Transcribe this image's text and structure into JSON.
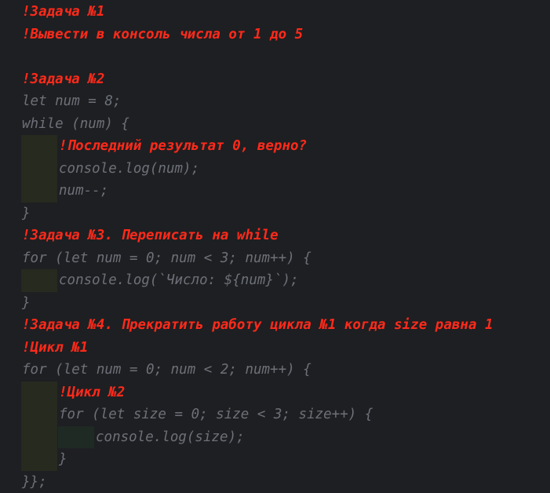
{
  "colors": {
    "background": "#1e1f22",
    "code_text": "#6d7078",
    "comment_text": "#ff2a1a",
    "indent_guide_level1": "#272a1f",
    "indent_guide_level2": "#1f2a25"
  },
  "code_lines": [
    {
      "type": "comment",
      "indent": 0,
      "text": "!Задача №1"
    },
    {
      "type": "comment",
      "indent": 0,
      "text": "!Вывести в консоль числа от 1 до 5"
    },
    {
      "type": "blank",
      "indent": 0,
      "text": ""
    },
    {
      "type": "comment",
      "indent": 0,
      "text": "!Задача №2"
    },
    {
      "type": "code",
      "indent": 0,
      "text": "let num = 8;"
    },
    {
      "type": "code",
      "indent": 0,
      "text": "while (num) {"
    },
    {
      "type": "comment",
      "indent": 1,
      "text": "!Последний результат 0, верно?"
    },
    {
      "type": "code",
      "indent": 1,
      "text": "console.log(num);"
    },
    {
      "type": "code",
      "indent": 1,
      "text": "num--;"
    },
    {
      "type": "code",
      "indent": 0,
      "text": "}"
    },
    {
      "type": "comment",
      "indent": 0,
      "text": "!Задача №3. Переписать на while"
    },
    {
      "type": "code",
      "indent": 0,
      "text": "for (let num = 0; num < 3; num++) {"
    },
    {
      "type": "code",
      "indent": 1,
      "text": "console.log(`Число: ${num}`);"
    },
    {
      "type": "code",
      "indent": 0,
      "text": "}"
    },
    {
      "type": "comment",
      "indent": 0,
      "text": "!Задача №4. Прекратить работу цикла №1 когда size равна 1"
    },
    {
      "type": "comment",
      "indent": 0,
      "text": "!Цикл №1"
    },
    {
      "type": "code",
      "indent": 0,
      "text": "for (let num = 0; num < 2; num++) {"
    },
    {
      "type": "comment",
      "indent": 1,
      "text": "!Цикл №2"
    },
    {
      "type": "code",
      "indent": 1,
      "text": "for (let size = 0; size < 3; size++) {"
    },
    {
      "type": "code",
      "indent": 2,
      "text": "console.log(size);"
    },
    {
      "type": "code",
      "indent": 1,
      "text": "}"
    },
    {
      "type": "code",
      "indent": 0,
      "text": "}};"
    }
  ]
}
